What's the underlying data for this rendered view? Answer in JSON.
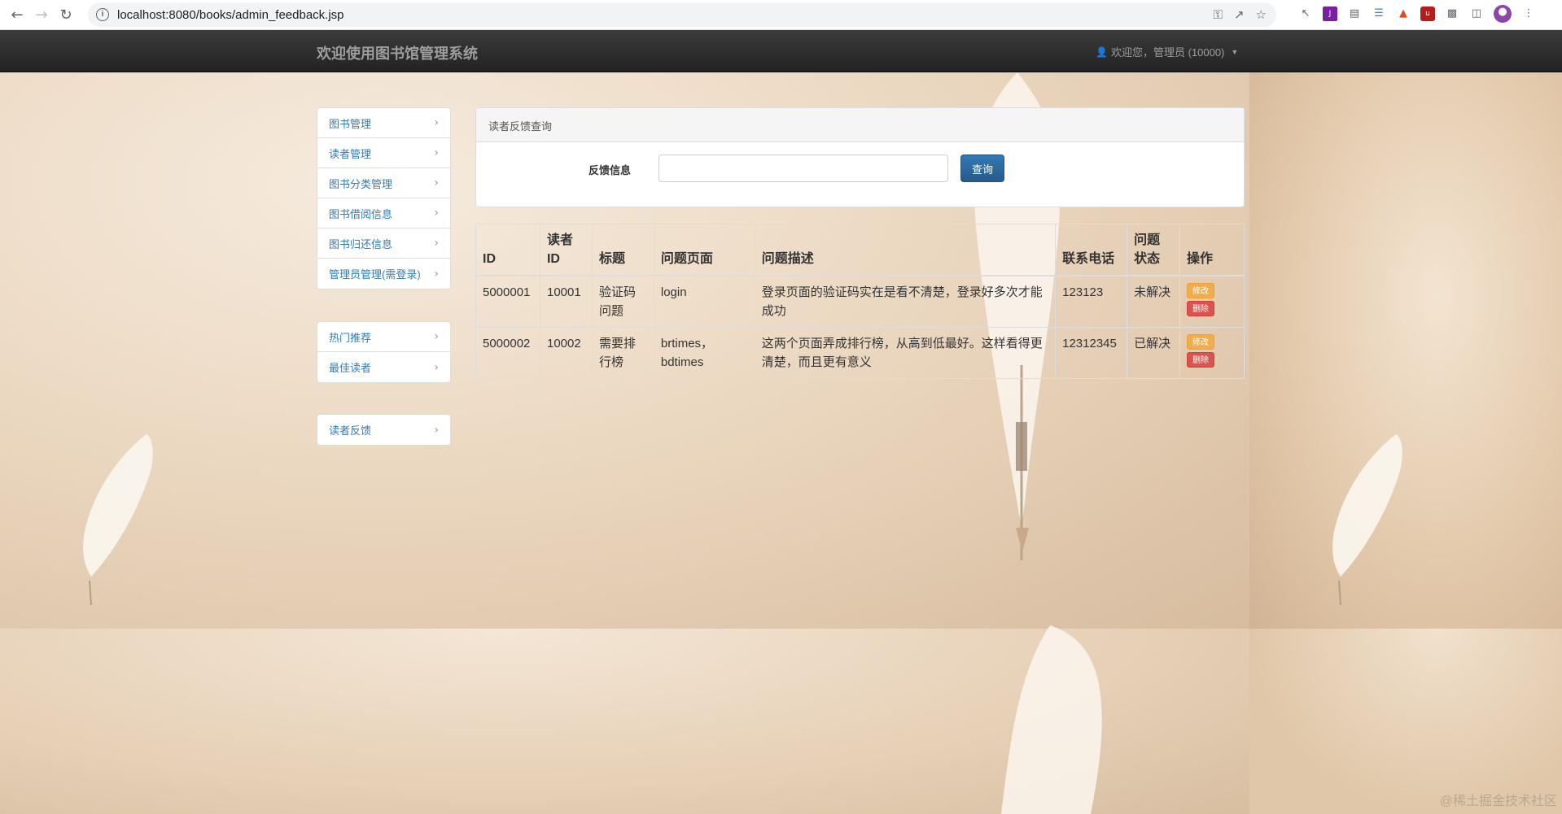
{
  "browser": {
    "url": "localhost:8080/books/admin_feedback.jsp"
  },
  "navbar": {
    "brand": "欢迎使用图书馆管理系统",
    "user": "欢迎您，管理员 (10000)"
  },
  "sidebar": {
    "group1": [
      {
        "label": "图书管理"
      },
      {
        "label": "读者管理"
      },
      {
        "label": "图书分类管理"
      },
      {
        "label": "图书借阅信息"
      },
      {
        "label": "图书归还信息"
      },
      {
        "label": "管理员管理(需登录)"
      }
    ],
    "group2": [
      {
        "label": "热门推荐"
      },
      {
        "label": "最佳读者"
      }
    ],
    "group3": [
      {
        "label": "读者反馈"
      }
    ]
  },
  "search": {
    "heading": "读者反馈查询",
    "label": "反馈信息",
    "input_value": "",
    "button": "查询"
  },
  "table": {
    "headers": [
      "ID",
      "读者ID",
      "标题",
      "问题页面",
      "问题描述",
      "联系电话",
      "问题状态",
      "操作"
    ],
    "rows": [
      {
        "id": "5000001",
        "reader_id": "10001",
        "title": "验证码问题",
        "page": "login",
        "desc": "登录页面的验证码实在是看不清楚，登录好多次才能成功",
        "phone": "123123",
        "status": "未解决"
      },
      {
        "id": "5000002",
        "reader_id": "10002",
        "title": "需要排行榜",
        "page": "brtimes，bdtimes",
        "desc": "这两个页面弄成排行榜，从高到低最好。这样看得更清楚，而且更有意义",
        "phone": "12312345",
        "status": "已解决"
      }
    ],
    "edit_label": "修改",
    "delete_label": "删除"
  },
  "watermark": "@稀土掘金技术社区"
}
